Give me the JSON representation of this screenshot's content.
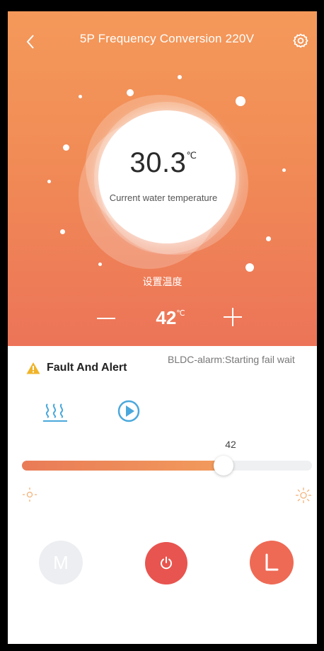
{
  "header": {
    "title": "5P Frequency Conversion 220V",
    "back_icon": "chevron-left-icon",
    "settings_icon": "gear-icon"
  },
  "water": {
    "value": "30.3",
    "unit": "℃",
    "caption": "Current water temperature"
  },
  "setpoint": {
    "label": "设置温度",
    "value": "42",
    "unit": "℃"
  },
  "fault": {
    "title": "Fault And Alert",
    "message": "BLDC-alarm:Starting fail wait",
    "icon": "warning-icon"
  },
  "modes": {
    "heat_icon": "heating-icon",
    "play_icon": "play-icon"
  },
  "slider": {
    "value_label": "42",
    "level_fraction": 0.695
  },
  "bottom": {
    "mode_label": "M",
    "power_icon": "power-icon",
    "timer_icon": "timer-icon"
  },
  "colors": {
    "gradient_top": "#f4995a",
    "gradient_bottom": "#ec7458",
    "accent_blue": "#4aa8dc",
    "power_red": "#e8544f",
    "warning_yellow": "#f0b429"
  }
}
